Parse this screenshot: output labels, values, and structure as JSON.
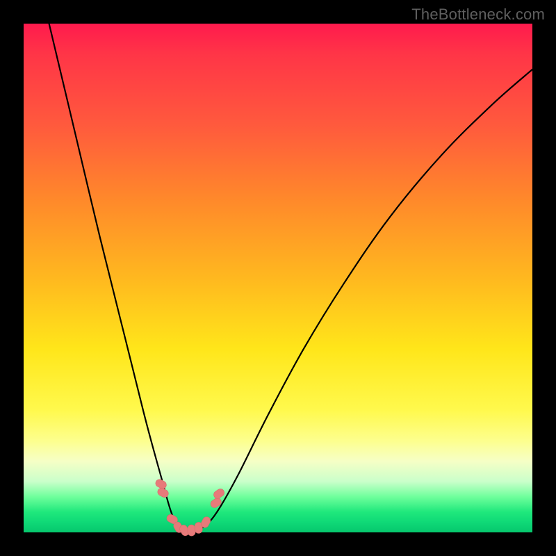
{
  "watermark": "TheBottleneck.com",
  "colors": {
    "frame": "#000000",
    "curve_stroke": "#000000",
    "marker_fill": "#e77a7a",
    "marker_stroke": "#d96b6b"
  },
  "chart_data": {
    "type": "line",
    "title": "",
    "xlabel": "",
    "ylabel": "",
    "xlim": [
      0,
      100
    ],
    "ylim": [
      0,
      100
    ],
    "grid": false,
    "legend": false,
    "note": "Unlabeled bottleneck curve. x ≈ component balance (arbitrary 0–100), y ≈ bottleneck % (0 at valley). Values estimated from pixel positions; chart has no numeric axes.",
    "series": [
      {
        "name": "bottleneck-curve",
        "x": [
          5,
          10,
          15,
          20,
          24,
          27,
          29,
          30.5,
          32,
          33.5,
          35.5,
          38,
          42,
          48,
          55,
          63,
          72,
          82,
          92,
          100
        ],
        "y": [
          100,
          79,
          58,
          38,
          22,
          11,
          4,
          1.2,
          0.3,
          0.3,
          1.2,
          4,
          11,
          23,
          36,
          49,
          62,
          74,
          84,
          91
        ]
      }
    ],
    "markers": {
      "note": "Short dashed/beaded pink segment near the valley floor. Values in same 0–100 space.",
      "points": [
        {
          "x": 27.0,
          "y": 9.5
        },
        {
          "x": 27.4,
          "y": 7.8
        },
        {
          "x": 29.2,
          "y": 2.6
        },
        {
          "x": 30.4,
          "y": 1.0
        },
        {
          "x": 31.6,
          "y": 0.4
        },
        {
          "x": 33.0,
          "y": 0.4
        },
        {
          "x": 34.4,
          "y": 0.9
        },
        {
          "x": 35.8,
          "y": 2.0
        },
        {
          "x": 37.8,
          "y": 5.8
        },
        {
          "x": 38.4,
          "y": 7.6
        }
      ]
    }
  }
}
